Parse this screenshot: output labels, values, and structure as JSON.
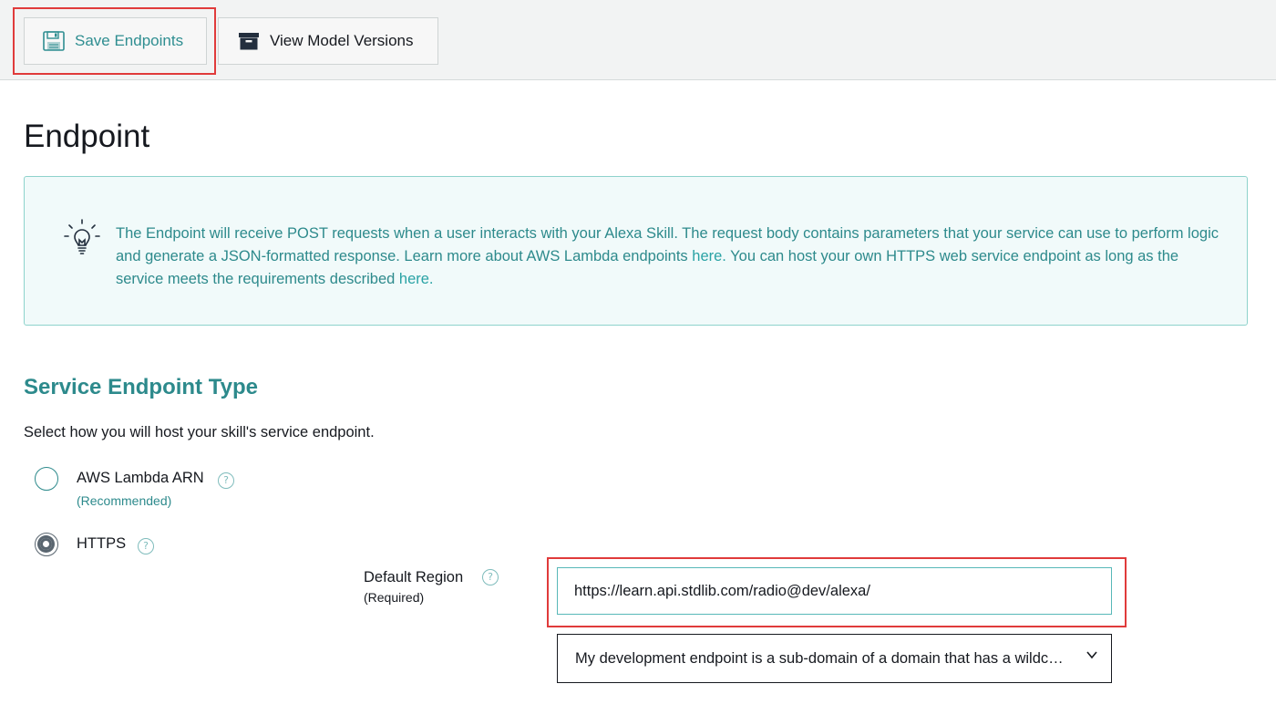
{
  "toolbar": {
    "save_label": "Save Endpoints",
    "versions_label": "View Model Versions"
  },
  "page": {
    "title": "Endpoint"
  },
  "info": {
    "text_1": "The Endpoint will receive POST requests when a user interacts with your Alexa Skill. The request body contains parameters that your service can use to perform logic and generate a JSON-formatted response. Learn more about AWS Lambda endpoints ",
    "link_1": "here.",
    "text_2": " You can host your own HTTPS web service endpoint as long as the service meets the requirements described ",
    "link_2": "here."
  },
  "service": {
    "title": "Service Endpoint Type",
    "description": "Select how you will host your skill's service endpoint.",
    "options": [
      {
        "label": "AWS Lambda ARN",
        "sublabel": "(Recommended)",
        "selected": false
      },
      {
        "label": "HTTPS",
        "selected": true
      }
    ]
  },
  "region": {
    "label": "Default Region",
    "sublabel": "(Required)",
    "url_value": "https://learn.api.stdlib.com/radio@dev/alexa/",
    "cert_option": "My development endpoint is a sub-domain of a domain that has a wildc…"
  },
  "help_glyph": "?",
  "colors": {
    "accent": "#2d8a8c",
    "highlight": "#e03b3b",
    "info_bg": "#f1fafa"
  }
}
